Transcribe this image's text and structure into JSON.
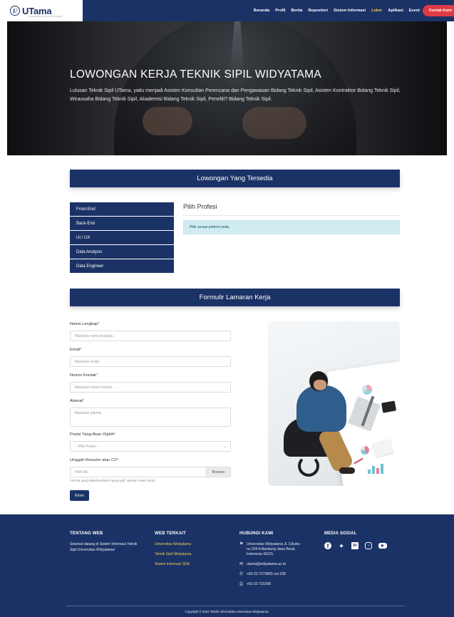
{
  "navbar": {
    "logo_mark": "U",
    "logo_text": "UTama",
    "logo_sub": "UNIVERSITAS WIDYATAMA",
    "links": [
      {
        "label": "Beranda",
        "active": false
      },
      {
        "label": "Profil",
        "active": false
      },
      {
        "label": "Berita",
        "active": false
      },
      {
        "label": "Repositori",
        "active": false
      },
      {
        "label": "Sistem Informasi",
        "active": false
      },
      {
        "label": "Loker",
        "active": true
      },
      {
        "label": "Aplikasi",
        "active": false
      },
      {
        "label": "Event",
        "active": false
      }
    ],
    "cta": "Kontak Kami"
  },
  "hero": {
    "title": "LOWONGAN KERJA TEKNIK SIPIL WIDYATAMA",
    "description": "Lulusan Teknik Sipil UTama, yaitu menjadi Asisten Konsultan Perencana dan Pengawasan Bidang Teknik Sipil, Asisten Kontraktor Bidang Teknik Sipil, Wirausaha Bidang Teknik Sipil, Akademisi Bidang Teknik Sipil, Peneliti? Bidang Teknik Sipil."
  },
  "lowongan": {
    "header": "Lowongan Yang Tersedia",
    "professions": [
      "Front-End",
      "Back-End",
      "UI / UX",
      "Data Analysis",
      "Data Engineer"
    ],
    "panel_title": "Pilih Profesi",
    "panel_alert": "Pilih sesuai potensi anda."
  },
  "form": {
    "header": "Formulir Lamaran Kerja",
    "name_label": "Nama Lengkap",
    "name_placeholder": "Masukan nama lengkap..",
    "email_label": "Email",
    "email_placeholder": "Masukan email..",
    "phone_label": "Nomor Kontak",
    "phone_placeholder": "Masukan nomor kontak..",
    "address_label": "Alamat",
    "address_placeholder": "Masukan alamat..",
    "position_label": "Posisi Yang Akan Dipilih",
    "position_selected": "-- Pilih Posisi --",
    "cv_label": "Unggah Resume atau CV",
    "cv_placeholder": "Pilih File",
    "cv_browse": "Browse",
    "cv_help": "Format yang diperbolehkan hanya pdf. Ukuran maks 20mb.",
    "required_mark": "*",
    "submit": "Kirim"
  },
  "footer": {
    "about_title": "TENTANG WEB",
    "about_text": "Selamat datang di Sistem Informasi Teknik Sipil Universitas Widyatama!",
    "related_title": "WEB TERKAIT",
    "related_links": [
      "Universitas Widyatama",
      "Teknik Sipil Widyatama",
      "Sistem Informasi SDA"
    ],
    "contact_title": "HUBUNGI KAMI",
    "address": "Universitas Widyatama Jl. Cikutra no 204 A Bandung Jawa Barat, Indonesia 40125",
    "email": "utama@widyatama.ac.id",
    "phone": "+62-22-7275855 ext 228",
    "fax": "+62-22-720299",
    "social_title": "MEDIA SOSIAL",
    "social_icons": [
      "facebook-icon",
      "twitter-icon",
      "linkedin-icon",
      "instagram-icon",
      "youtube-icon"
    ],
    "copyright": "Copyright © 2022 Teknik Informatika Universitas Widyatama."
  },
  "colors": {
    "primary": "#1b3266",
    "accent": "#f2c94c",
    "cta": "#e03a46",
    "alert_bg": "#d1ecf1"
  }
}
